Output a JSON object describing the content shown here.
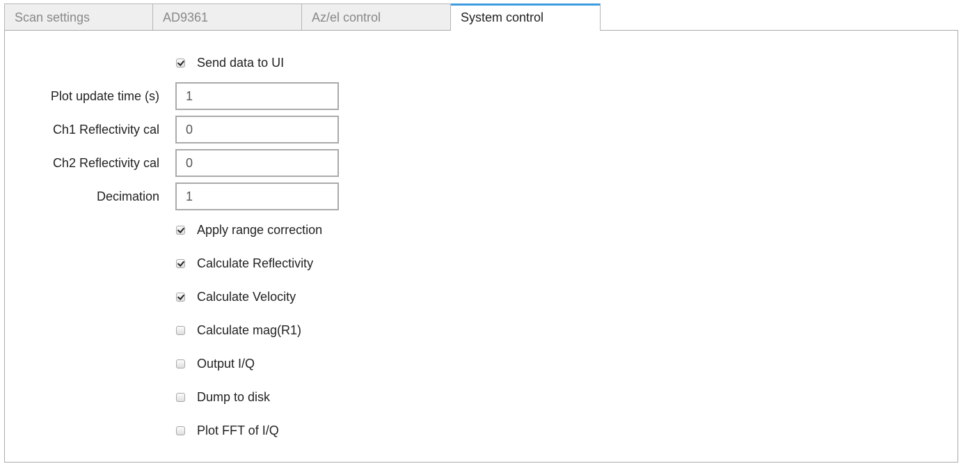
{
  "tabs": [
    {
      "label": "Scan settings",
      "active": false
    },
    {
      "label": "AD9361",
      "active": false
    },
    {
      "label": "Az/el control",
      "active": false
    },
    {
      "label": "System control",
      "active": true
    }
  ],
  "accent_color": "#3d9be0",
  "send_data": {
    "label": "Send data to UI",
    "checked": true
  },
  "fields": [
    {
      "label": "Plot update time (s)",
      "value": "1"
    },
    {
      "label": "Ch1 Reflectivity cal",
      "value": "0"
    },
    {
      "label": "Ch2 Reflectivity cal",
      "value": "0"
    },
    {
      "label": "Decimation",
      "value": "1"
    }
  ],
  "options": [
    {
      "label": "Apply range correction",
      "checked": true
    },
    {
      "label": "Calculate Reflectivity",
      "checked": true
    },
    {
      "label": "Calculate Velocity",
      "checked": true
    },
    {
      "label": "Calculate mag(R1)",
      "checked": false
    },
    {
      "label": "Output I/Q",
      "checked": false
    },
    {
      "label": "Dump to disk",
      "checked": false
    },
    {
      "label": "Plot FFT of I/Q",
      "checked": false
    }
  ]
}
